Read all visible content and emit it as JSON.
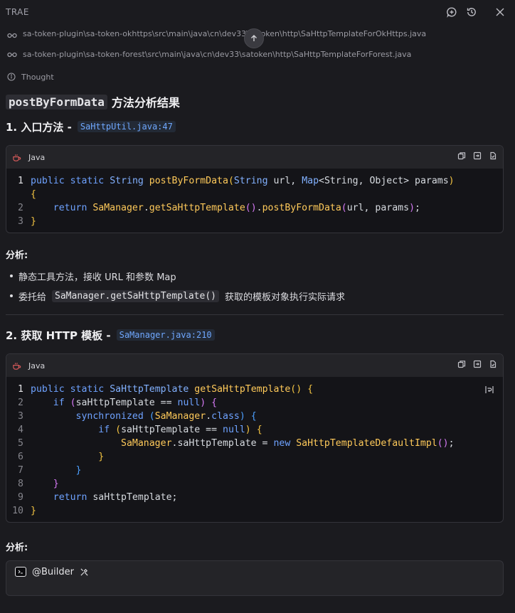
{
  "app": {
    "title": "TRAE"
  },
  "titlebar": {
    "icons": [
      "add-chat-icon",
      "history-icon",
      "close-icon"
    ]
  },
  "file_refs": [
    "sa-token-plugin\\sa-token-okhttps\\src\\main\\java\\cn\\dev33\\satoken\\http\\SaHttpTemplateForOkHttps.java",
    "sa-token-plugin\\sa-token-forest\\src\\main\\java\\cn\\dev33\\satoken\\http\\SaHttpTemplateForForest.java"
  ],
  "thought_label": "Thought",
  "heading": {
    "code": "postByFormData",
    "text": "方法分析结果"
  },
  "step1": {
    "title": "1. 入口方法 -",
    "file": "SaHttpUtil.java:47",
    "lang": "Java",
    "line_numbers": [
      "1",
      "2",
      "3"
    ],
    "analysis_label": "分析:",
    "bullets": [
      {
        "text": "静态工具方法，接收 URL 和参数 Map"
      },
      {
        "pre": "委托给",
        "code": "SaManager.getSaHttpTemplate()",
        "post": "获取的模板对象执行实际请求"
      }
    ]
  },
  "step2": {
    "title": "2. 获取 HTTP 模板 -",
    "file": "SaManager.java:210",
    "lang": "Java",
    "line_numbers": [
      "1",
      "2",
      "3",
      "4",
      "5",
      "6",
      "7",
      "8",
      "9",
      "10"
    ],
    "analysis_label": "分析:"
  },
  "builder": {
    "label": "@Builder"
  }
}
